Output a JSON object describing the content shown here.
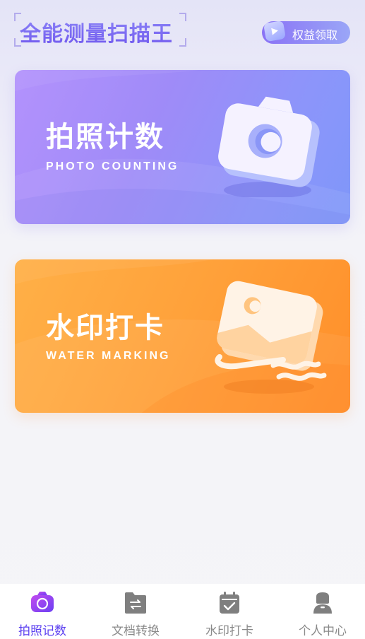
{
  "header": {
    "app_title": "全能测量扫描王",
    "benefits_button_label": "权益领取"
  },
  "cards": [
    {
      "title": "拍照计数",
      "subtitle": "PHOTO COUNTING"
    },
    {
      "title": "水印打卡",
      "subtitle": "WATER MARKING"
    }
  ],
  "bottom_nav": {
    "items": [
      {
        "label": "拍照记数",
        "icon": "camera-icon",
        "active": true
      },
      {
        "label": "文档转换",
        "icon": "document-convert-icon",
        "active": false
      },
      {
        "label": "水印打卡",
        "icon": "calendar-check-icon",
        "active": false
      },
      {
        "label": "个人中心",
        "icon": "person-icon",
        "active": false
      }
    ]
  },
  "colors": {
    "accent": "#5b3ff0",
    "photo_card": "#9a8cf8",
    "water_card": "#ffa13a",
    "nav_inactive": "#8a8a8a"
  }
}
